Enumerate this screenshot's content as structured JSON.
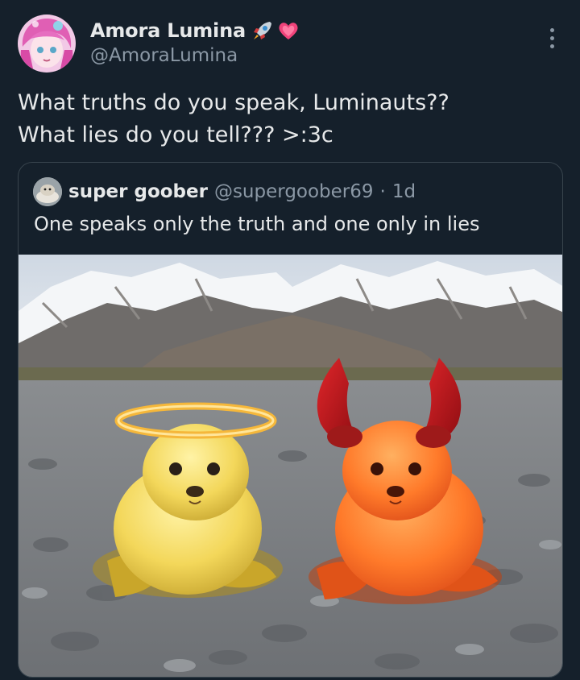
{
  "author": {
    "display_name": "Amora Lumina",
    "name_emojis": "🚀💗",
    "handle": "@AmoraLumina",
    "avatar_icon": "anime-avatar-icon"
  },
  "tweet": {
    "lines": [
      "What truths do you speak, Luminauts??",
      "What lies do you tell??? >:3c"
    ]
  },
  "quote": {
    "display_name": "super goober",
    "handle": "@supergoober69",
    "separator": "·",
    "time": "1d",
    "text": "One speaks only the truth and one only in lies",
    "media_icon": "angel-and-devil-seals-image"
  },
  "colors": {
    "background": "#15202b",
    "text_primary": "#e7e9ea",
    "text_secondary": "#8b98a5",
    "border": "#38444d"
  }
}
